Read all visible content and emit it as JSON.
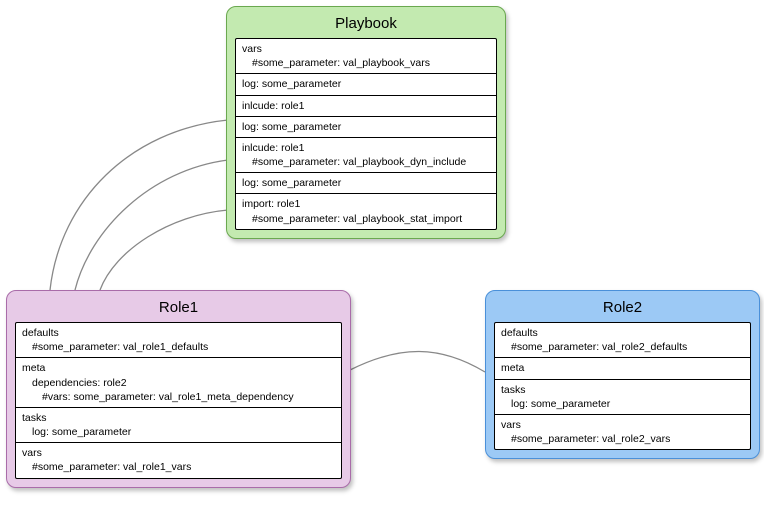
{
  "playbook": {
    "title": "Playbook",
    "cells": [
      {
        "l0": "vars",
        "l1": "#some_parameter: val_playbook_vars"
      },
      {
        "l0": "log: some_parameter"
      },
      {
        "l0": "inlcude: role1"
      },
      {
        "l0": "log: some_parameter"
      },
      {
        "l0": "inlcude: role1",
        "l1": "#some_parameter: val_playbook_dyn_include"
      },
      {
        "l0": "log: some_parameter"
      },
      {
        "l0": "import: role1",
        "l1": "#some_parameter: val_playbook_stat_import"
      }
    ]
  },
  "role1": {
    "title": "Role1",
    "cells": [
      {
        "l0": "defaults",
        "l1": "#some_parameter: val_role1_defaults"
      },
      {
        "l0": "meta",
        "l1": "dependencies: role2",
        "l2": "#vars: some_parameter: val_role1_meta_dependency"
      },
      {
        "l0": "tasks",
        "l1": "log: some_parameter"
      },
      {
        "l0": "vars",
        "l1": "#some_parameter: val_role1_vars"
      }
    ]
  },
  "role2": {
    "title": "Role2",
    "cells": [
      {
        "l0": "defaults",
        "l1": "#some_parameter: val_role2_defaults"
      },
      {
        "l0": "meta"
      },
      {
        "l0": "tasks",
        "l1": "log: some_parameter"
      },
      {
        "l0": "vars",
        "l1": "#some_parameter: val_role2_vars"
      }
    ]
  }
}
